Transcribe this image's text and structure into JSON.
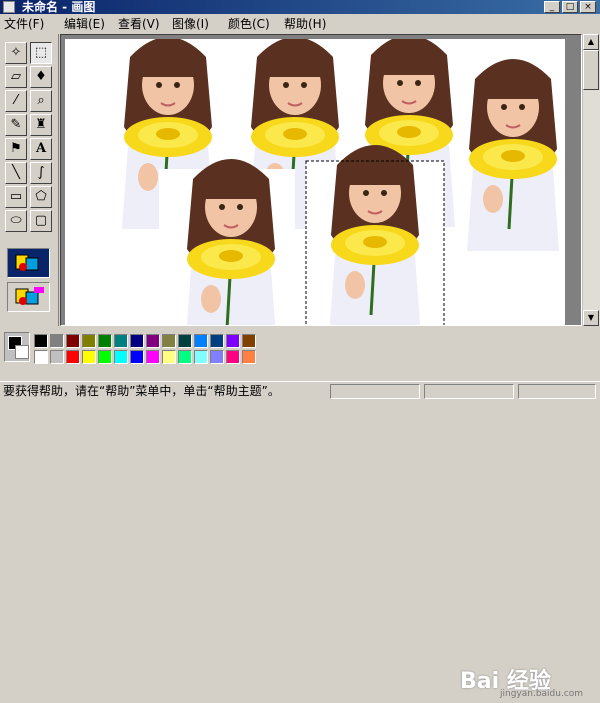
{
  "window": {
    "title": "未命名 - 画图"
  },
  "title_buttons": {
    "minimize": "_",
    "maximize": "□",
    "close": "×"
  },
  "menu": [
    {
      "label": "文件(F)"
    },
    {
      "label": "编辑(E)"
    },
    {
      "label": "查看(V)"
    },
    {
      "label": "图像(I)"
    },
    {
      "label": "颜色(C)"
    },
    {
      "label": "帮助(H)"
    }
  ],
  "tools": [
    {
      "name": "free-select-icon",
      "glyph": "✧"
    },
    {
      "name": "rect-select-icon",
      "glyph": "⬚"
    },
    {
      "name": "eraser-icon",
      "glyph": "▱"
    },
    {
      "name": "fill-bucket-icon",
      "glyph": "♦"
    },
    {
      "name": "color-picker-icon",
      "glyph": "⁄"
    },
    {
      "name": "magnifier-icon",
      "glyph": "⌕"
    },
    {
      "name": "pencil-icon",
      "glyph": "✎"
    },
    {
      "name": "brush-icon",
      "glyph": "♜"
    },
    {
      "name": "airbrush-icon",
      "glyph": "⚑"
    },
    {
      "name": "text-icon",
      "glyph": "A"
    },
    {
      "name": "line-icon",
      "glyph": "╲"
    },
    {
      "name": "curve-icon",
      "glyph": "∫"
    },
    {
      "name": "rectangle-icon",
      "glyph": "▭"
    },
    {
      "name": "polygon-icon",
      "glyph": "⬠"
    },
    {
      "name": "ellipse-icon",
      "glyph": "⬭"
    },
    {
      "name": "rounded-rect-icon",
      "glyph": "▢"
    }
  ],
  "scrollbar": {
    "up": "▲",
    "down": "▼"
  },
  "palette": {
    "top": [
      "#000000",
      "#808080",
      "#800000",
      "#808000",
      "#008000",
      "#008080",
      "#000080",
      "#800080",
      "#808040",
      "#004040",
      "#0080ff",
      "#004080",
      "#8000ff",
      "#804000"
    ],
    "bottom": [
      "#ffffff",
      "#c0c0c0",
      "#ff0000",
      "#ffff00",
      "#00ff00",
      "#00ffff",
      "#0000ff",
      "#ff00ff",
      "#ffff80",
      "#00ff80",
      "#80ffff",
      "#8080ff",
      "#ff0080",
      "#ff8040"
    ]
  },
  "watermark": {
    "logo": "Bai 经验",
    "url": "jingyan.baidu.com"
  },
  "status": {
    "text": "要获得帮助，请在“帮助”菜单中，单击“帮助主题”。"
  }
}
